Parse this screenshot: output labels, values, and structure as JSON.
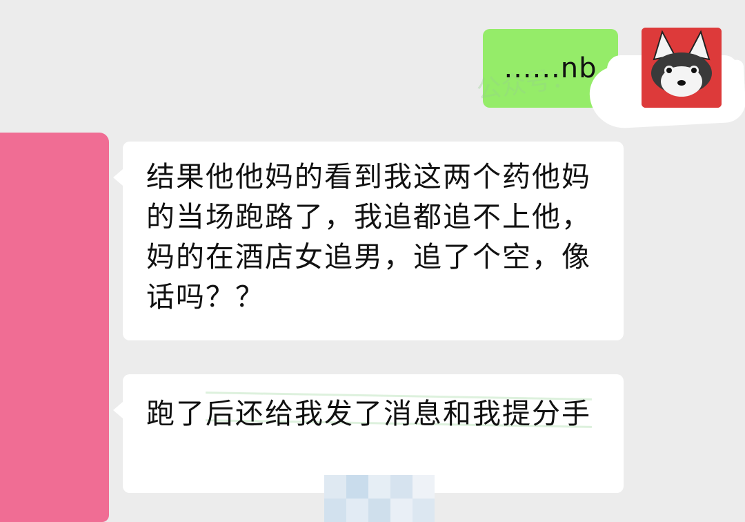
{
  "chat": {
    "messages": [
      {
        "sender": "self",
        "text": "......nb"
      },
      {
        "sender": "other",
        "text": "结果他他妈的看到我这两个药他妈的当场跑路了，我追都追不上他，妈的在酒店女追男，追了个空，像话吗？？"
      },
      {
        "sender": "other",
        "text": "跑了后还给我发了消息和我提分手"
      }
    ],
    "watermark": "公众号："
  },
  "colors": {
    "sent_bubble": "#95ec69",
    "received_bubble": "#ffffff",
    "background": "#ececec",
    "censor_pink": "#f06d94",
    "avatar_red": "#dd3a3a"
  },
  "icons": {
    "avatar_self": "husky-avatar-icon",
    "avatar_other": "censored-avatar"
  }
}
